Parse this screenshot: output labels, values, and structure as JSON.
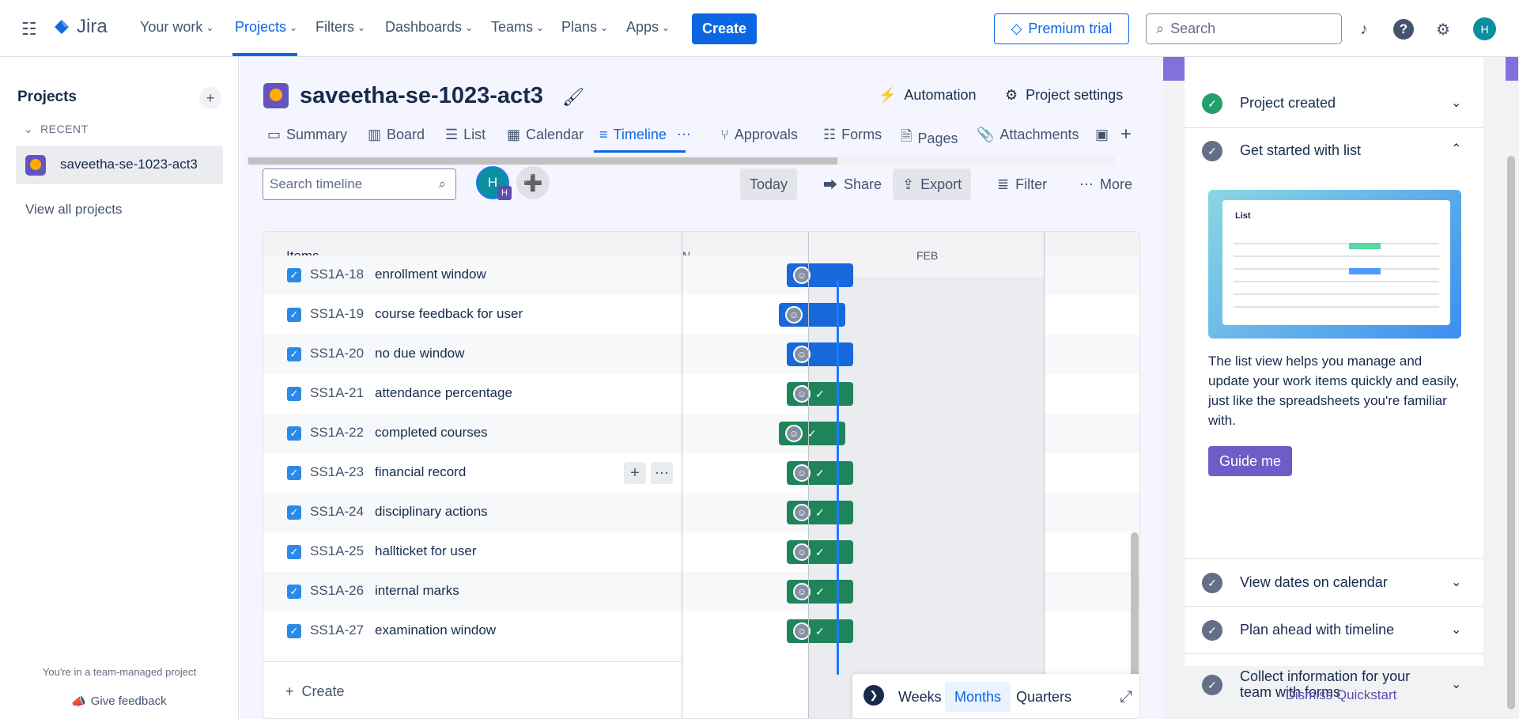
{
  "topnav": {
    "logo": "Jira",
    "items": [
      {
        "label": "Your work"
      },
      {
        "label": "Projects"
      },
      {
        "label": "Filters"
      },
      {
        "label": "Dashboards"
      },
      {
        "label": "Teams"
      },
      {
        "label": "Plans"
      },
      {
        "label": "Apps"
      }
    ],
    "create": "Create",
    "premium": "Premium trial",
    "search_placeholder": "Search",
    "avatar": "H"
  },
  "sidebar": {
    "title": "Projects",
    "recent": "RECENT",
    "project": "saveetha-se-1023-act3",
    "view_all": "View all projects",
    "team_note": "You're in a team-managed project",
    "feedback": "Give feedback"
  },
  "project": {
    "title": "saveetha-se-1023-act3",
    "automation": "Automation",
    "settings": "Project settings"
  },
  "tabs": [
    {
      "label": "Summary",
      "icon": "summary-icon"
    },
    {
      "label": "Board",
      "icon": "board-icon"
    },
    {
      "label": "List",
      "icon": "list-icon"
    },
    {
      "label": "Calendar",
      "icon": "calendar-icon"
    },
    {
      "label": "Timeline",
      "icon": "timeline-icon"
    },
    {
      "label": "Approvals",
      "icon": "approvals-icon"
    },
    {
      "label": "Forms",
      "icon": "forms-icon"
    },
    {
      "label": "Pages",
      "icon": "pages-icon"
    },
    {
      "label": "Attachments",
      "icon": "attachments-icon"
    }
  ],
  "toolbar": {
    "search_placeholder": "Search timeline",
    "avatar": "H",
    "avatar_sub": "H",
    "today": "Today",
    "share": "Share",
    "export": "Export",
    "filter": "Filter",
    "more": "More"
  },
  "timeline": {
    "items_header": "Items",
    "month_prev": "N",
    "month_feb": "FEB",
    "create": "Create",
    "rows": [
      {
        "key": "SS1A-18",
        "summary": "enrollment window",
        "status": "blue",
        "done": false
      },
      {
        "key": "SS1A-19",
        "summary": "course feedback for user",
        "status": "blue",
        "done": false
      },
      {
        "key": "SS1A-20",
        "summary": "no due window",
        "status": "blue",
        "done": false
      },
      {
        "key": "SS1A-21",
        "summary": "attendance percentage",
        "status": "green",
        "done": true
      },
      {
        "key": "SS1A-22",
        "summary": "completed courses",
        "status": "green",
        "done": true
      },
      {
        "key": "SS1A-23",
        "summary": "financial record",
        "status": "green",
        "done": true
      },
      {
        "key": "SS1A-24",
        "summary": "disciplinary actions",
        "status": "green",
        "done": true
      },
      {
        "key": "SS1A-25",
        "summary": "hallticket for user",
        "status": "green",
        "done": true
      },
      {
        "key": "SS1A-26",
        "summary": "internal marks",
        "status": "green",
        "done": true
      },
      {
        "key": "SS1A-27",
        "summary": "examination window",
        "status": "green",
        "done": true
      }
    ],
    "zoom": {
      "weeks": "Weeks",
      "months": "Months",
      "quarters": "Quarters",
      "selected": "Months"
    }
  },
  "quickstart": {
    "items": [
      {
        "label": "Project created",
        "done": true
      },
      {
        "label": "Get started with list",
        "done": false
      },
      {
        "label": "View dates on calendar",
        "done": false
      },
      {
        "label": "Plan ahead with timeline",
        "done": false
      },
      {
        "label": "Collect information for your team with forms",
        "done": false
      }
    ],
    "illustration_title": "List",
    "description": "The list view helps you manage and update your work items quickly and easily, just like the spreadsheets you're familiar with.",
    "guide_me": "Guide me",
    "dismiss": "Dismiss Quickstart"
  },
  "colors": {
    "accent": "#0c66e4",
    "done": "#1f845a",
    "inprogress": "#1868db",
    "quickstart": "#6e5dc6"
  }
}
